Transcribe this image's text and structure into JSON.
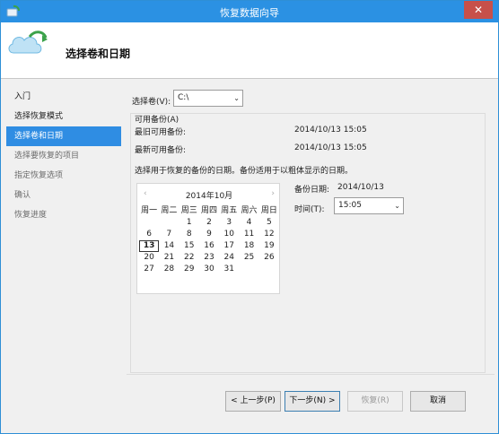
{
  "window": {
    "title": "恢复数据向导",
    "close_glyph": "✕"
  },
  "header": {
    "title": "选择卷和日期"
  },
  "nav": {
    "items": [
      {
        "label": "入门"
      },
      {
        "label": "选择恢复模式"
      },
      {
        "label": "选择卷和日期"
      },
      {
        "label": "选择要恢复的项目"
      },
      {
        "label": "指定恢复选项"
      },
      {
        "label": "确认"
      },
      {
        "label": "恢复进度"
      }
    ]
  },
  "volume": {
    "label": "选择卷(V):",
    "value": "C:\\",
    "arrow": "⌄"
  },
  "available": {
    "group_title": "可用备份(A)",
    "oldest_label": "最旧可用备份:",
    "oldest_value": "2014/10/13 15:05",
    "newest_label": "最新可用备份:",
    "newest_value": "2014/10/13 15:05"
  },
  "instruction": "选择用于恢复的备份的日期。备份适用于以粗体显示的日期。",
  "calendar": {
    "month_label": "2014年10月",
    "prev": "‹",
    "next": "›",
    "weekdays": [
      "周一",
      "周二",
      "周三",
      "周四",
      "周五",
      "周六",
      "周日"
    ],
    "weeks": [
      [
        "",
        "",
        "1",
        "2",
        "3",
        "4",
        "5"
      ],
      [
        "6",
        "7",
        "8",
        "9",
        "10",
        "11",
        "12"
      ],
      [
        "13",
        "14",
        "15",
        "16",
        "17",
        "18",
        "19"
      ],
      [
        "20",
        "21",
        "22",
        "23",
        "24",
        "25",
        "26"
      ],
      [
        "27",
        "28",
        "29",
        "30",
        "31",
        "",
        ""
      ]
    ],
    "selected_day": "13"
  },
  "backup_date": {
    "label": "备份日期:",
    "value": "2014/10/13"
  },
  "time": {
    "label": "时间(T):",
    "value": "15:05",
    "arrow": "⌄"
  },
  "buttons": {
    "back": "< 上一步(P)",
    "next": "下一步(N) >",
    "recover": "恢复(R)",
    "cancel": "取消"
  }
}
